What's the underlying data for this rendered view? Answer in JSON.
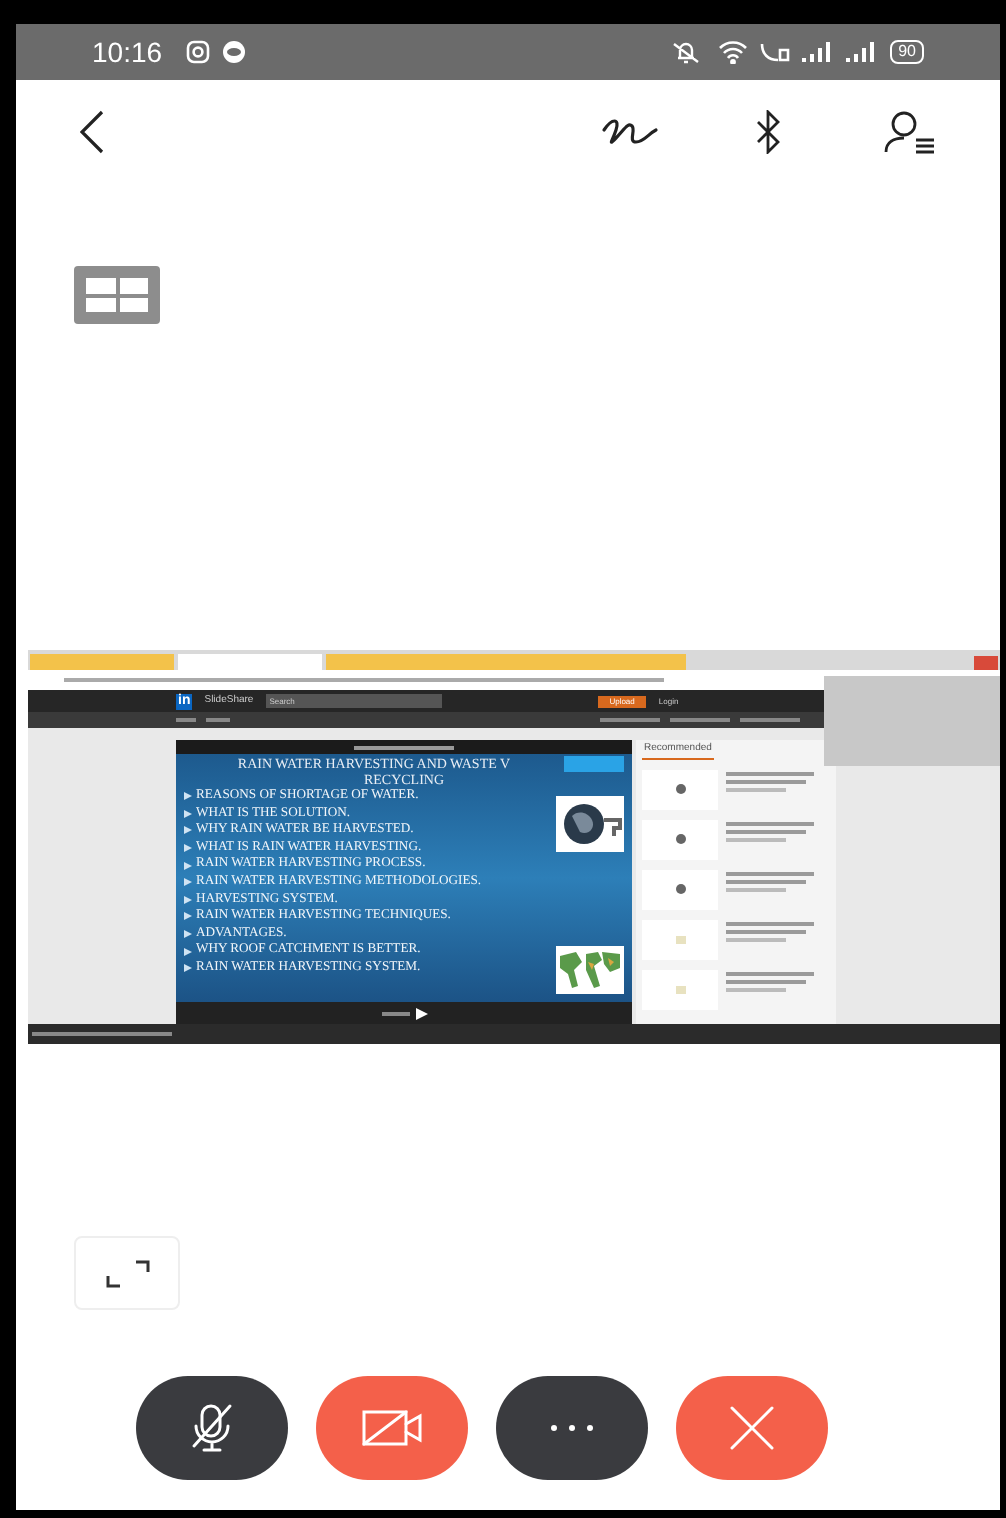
{
  "status_bar": {
    "time": "10:16",
    "battery": "90"
  },
  "shared_screen": {
    "browser_tabs": [
      {
        "selected": false
      },
      {
        "selected": true
      },
      {
        "selected": false
      }
    ],
    "site": {
      "logo": "in",
      "brand": "SlideShare",
      "search": "Search",
      "upload": "Upload",
      "login": "Login"
    },
    "slide": {
      "title": "RAIN WATER HARVESTING AND WASTE V",
      "subtitle": "RECYCLING",
      "bullets": [
        "REASONS OF SHORTAGE OF WATER.",
        "WHAT IS THE SOLUTION.",
        "WHY RAIN WATER BE HARVESTED.",
        "WHAT IS RAIN WATER HARVESTING.",
        "RAIN WATER HARVESTING PROCESS.",
        "RAIN WATER HARVESTING METHODOLOGIES.",
        "HARVESTING SYSTEM.",
        "RAIN WATER HARVESTING TECHNIQUES.",
        "ADVANTAGES.",
        "WHY ROOF CATCHMENT IS BETTER.",
        "RAIN WATER HARVESTING SYSTEM."
      ]
    },
    "sidebar": {
      "tab": "Recommended"
    }
  },
  "call_controls": [
    {
      "kind": "mic",
      "color": "#3a3b3f"
    },
    {
      "kind": "video",
      "color": "#f4604a"
    },
    {
      "kind": "more",
      "color": "#3a3b3f"
    },
    {
      "kind": "end",
      "color": "#f4604a"
    }
  ]
}
